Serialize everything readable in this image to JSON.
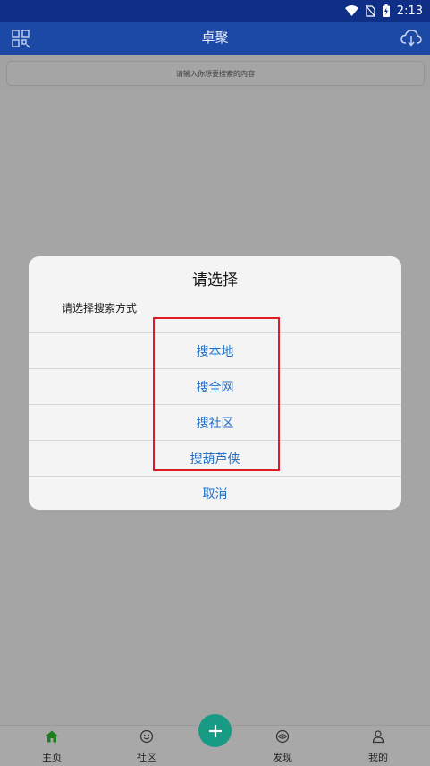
{
  "status_bar": {
    "time": "2:13"
  },
  "app_bar": {
    "title": "卓聚",
    "left_icon": "grid-scan-icon",
    "right_icon": "cloud-download-icon"
  },
  "search": {
    "placeholder": "请输入你想要搜索的内容"
  },
  "dialog": {
    "title": "请选择",
    "message": "请选择搜索方式",
    "options": [
      "搜本地",
      "搜全网",
      "搜社区",
      "搜葫芦侠"
    ],
    "cancel": "取消"
  },
  "bottom_nav": {
    "items": [
      {
        "label": "主页",
        "icon": "home-icon"
      },
      {
        "label": "社区",
        "icon": "smile-icon"
      },
      {
        "label": "发现",
        "icon": "eye-icon"
      },
      {
        "label": "我的",
        "icon": "person-icon"
      }
    ],
    "fab_icon": "plus-icon"
  },
  "colors": {
    "app_bar": "#1c49a6",
    "status_bar": "#0f2f87",
    "option_text": "#1f6fc7",
    "highlight": "#e01b24",
    "fab": "#189b85",
    "home_active": "#1e7d1e"
  }
}
